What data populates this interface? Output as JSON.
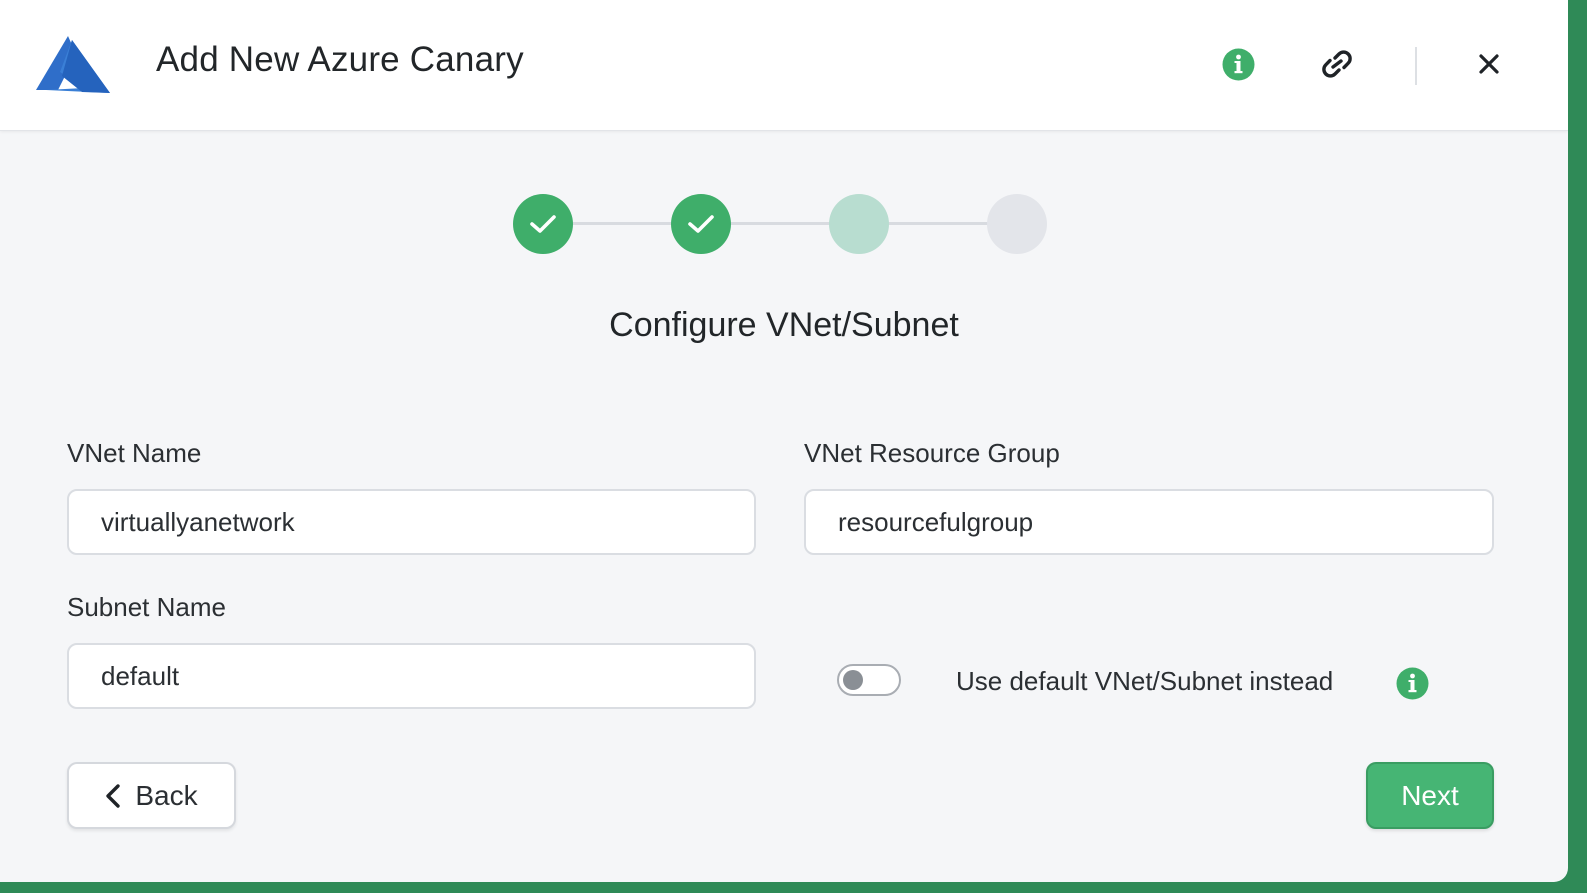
{
  "header": {
    "title": "Add New Azure Canary",
    "icons": [
      "azure-logo",
      "info-icon",
      "link-icon",
      "close-icon"
    ]
  },
  "stepper": {
    "steps": [
      {
        "state": "done"
      },
      {
        "state": "done"
      },
      {
        "state": "current"
      },
      {
        "state": "todo"
      }
    ]
  },
  "page": {
    "subtitle": "Configure VNet/Subnet"
  },
  "form": {
    "vnet_name_label": "VNet Name",
    "vnet_name_value": "virtuallyanetwork",
    "vnet_rg_label": "VNet Resource Group",
    "vnet_rg_value": "resourcefulgroup",
    "subnet_name_label": "Subnet Name",
    "subnet_name_value": "default",
    "toggle_label": "Use default VNet/Subnet instead",
    "toggle_on": false
  },
  "footer": {
    "back_label": "Back",
    "next_label": "Next"
  },
  "colors": {
    "accent": "#46b574",
    "azure_blue": "#2f6ec9"
  }
}
